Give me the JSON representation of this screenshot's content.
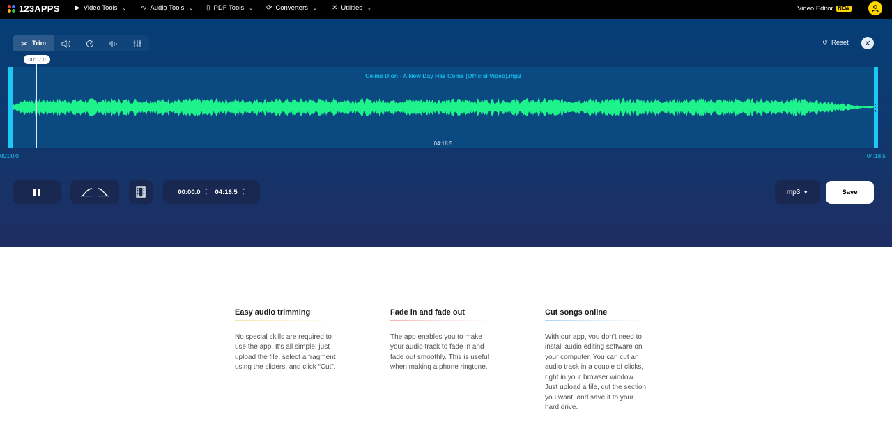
{
  "nav": {
    "logo": "123APPS",
    "logo_colors": [
      "#ff3d3d",
      "#3d7bff",
      "#ffb200",
      "#22c55e"
    ],
    "items": [
      {
        "label": "Video Tools",
        "icon": "video-icon"
      },
      {
        "label": "Audio Tools",
        "icon": "waveform-icon"
      },
      {
        "label": "PDF Tools",
        "icon": "document-icon"
      },
      {
        "label": "Converters",
        "icon": "convert-icon"
      },
      {
        "label": "Utilities",
        "icon": "tools-icon"
      }
    ],
    "video_editor": "Video Editor",
    "new_badge": "NEW"
  },
  "toolbar": {
    "trim_label": "Trim",
    "reset_label": "Reset",
    "close_icon": "close-icon"
  },
  "waveform": {
    "filename": "Céline Dion - A New Day Has Come (Official Video).mp3",
    "playhead": "00:07.0",
    "duration_mid": "04:18.5",
    "start_time": "00:00.0",
    "end_time": "04:18.5",
    "wave_color": "#1ef28a",
    "handle_color": "#1ec8f5"
  },
  "controls": {
    "start_field": "00:00.0",
    "end_field": "04:18.5",
    "format": "mp3",
    "save_label": "Save"
  },
  "info": [
    {
      "title": "Easy audio trimming",
      "text": "No special skills are required to use the app. It’s all simple: just upload the file, select a fragment using the sliders, and click “Cut”.",
      "accent": "#f6e3a6"
    },
    {
      "title": "Fade in and fade out",
      "text": "The app enables you to make your audio track to fade in and fade out smoothly. This is useful when making a phone ringtone.",
      "accent": "#f5b3b3"
    },
    {
      "title": "Cut songs online",
      "text": "With our app, you don’t need to install audio editing software on your computer. You can cut an audio track in a couple of clicks, right in your browser window. Just upload a file, cut the section you want, and save it to your hard drive.",
      "accent": "#a9d2f3"
    }
  ]
}
